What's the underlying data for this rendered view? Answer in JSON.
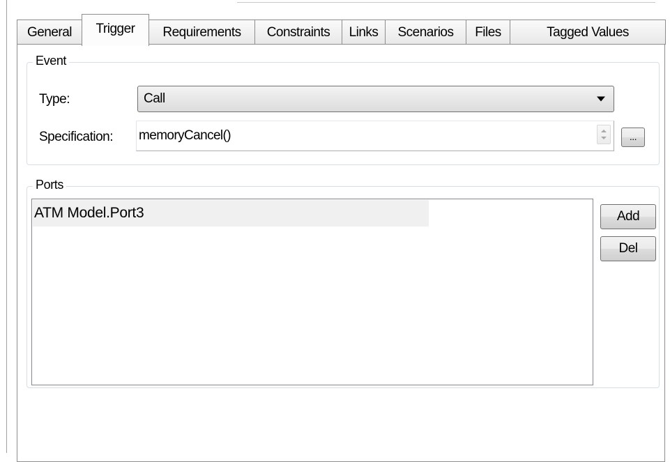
{
  "tabs": [
    {
      "label": "General"
    },
    {
      "label": "Trigger",
      "active": true
    },
    {
      "label": "Requirements"
    },
    {
      "label": "Constraints"
    },
    {
      "label": "Links"
    },
    {
      "label": "Scenarios"
    },
    {
      "label": "Files"
    },
    {
      "label": "Tagged Values"
    }
  ],
  "event": {
    "title": "Event",
    "type_label": "Type:",
    "type_value": "Call",
    "spec_label": "Specification:",
    "spec_value": "memoryCancel()",
    "browse_label": "..."
  },
  "ports": {
    "title": "Ports",
    "items": [
      "ATM Model.Port3"
    ],
    "add_label": "Add",
    "del_label": "Del"
  }
}
